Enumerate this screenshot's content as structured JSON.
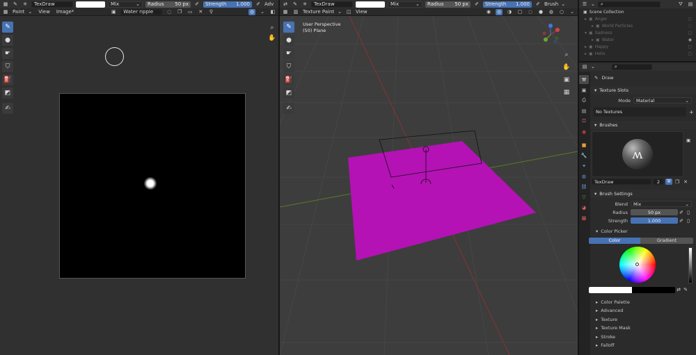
{
  "left_header": {
    "brush_name": "TexDraw",
    "blend": "Mix",
    "radius_label": "Radius",
    "radius_value": "50 px",
    "strength_label": "Strength",
    "strength_value": "1.000",
    "overflow": "Adv"
  },
  "left_menu": {
    "mode": "Paint",
    "view": "View",
    "image": "Image*",
    "image_name": "Water ripple"
  },
  "mid_header": {
    "brush_name": "TexDraw",
    "blend": "Mix",
    "radius_label": "Radius",
    "radius_value": "50 px",
    "strength_label": "Strength",
    "strength_value": "1.000",
    "brush_menu": "Brush"
  },
  "mid_menu": {
    "mode": "Texture Paint",
    "view": "View"
  },
  "viewport": {
    "title": "User Perspective",
    "subtitle": "(50) Plane",
    "plane_color": "#b412b4"
  },
  "outliner": {
    "title": "Scene Collection",
    "items": [
      "Anger",
      "World Particles",
      "Sadness",
      "Water",
      "Happy",
      "Helix"
    ]
  },
  "props": {
    "tool_name": "Draw",
    "texture_slots": {
      "title": "Texture Slots",
      "mode_label": "Mode",
      "mode_value": "Material",
      "empty": "No Textures"
    },
    "brushes": {
      "title": "Brushes",
      "brush_name": "TexDraw",
      "users": "2"
    },
    "brush_settings": {
      "title": "Brush Settings",
      "blend_label": "Blend",
      "blend_value": "Mix",
      "radius_label": "Radius",
      "radius_value": "50 px",
      "strength_label": "Strength",
      "strength_value": "1.000"
    },
    "color_picker": {
      "title": "Color Picker",
      "tab_color": "Color",
      "tab_gradient": "Gradient"
    },
    "subpanels": [
      "Color Palette",
      "Advanced",
      "Texture",
      "Texture Mask",
      "Stroke",
      "Falloff"
    ]
  },
  "colors": {
    "accent": "#4772b3",
    "plane": "#b412b4"
  }
}
